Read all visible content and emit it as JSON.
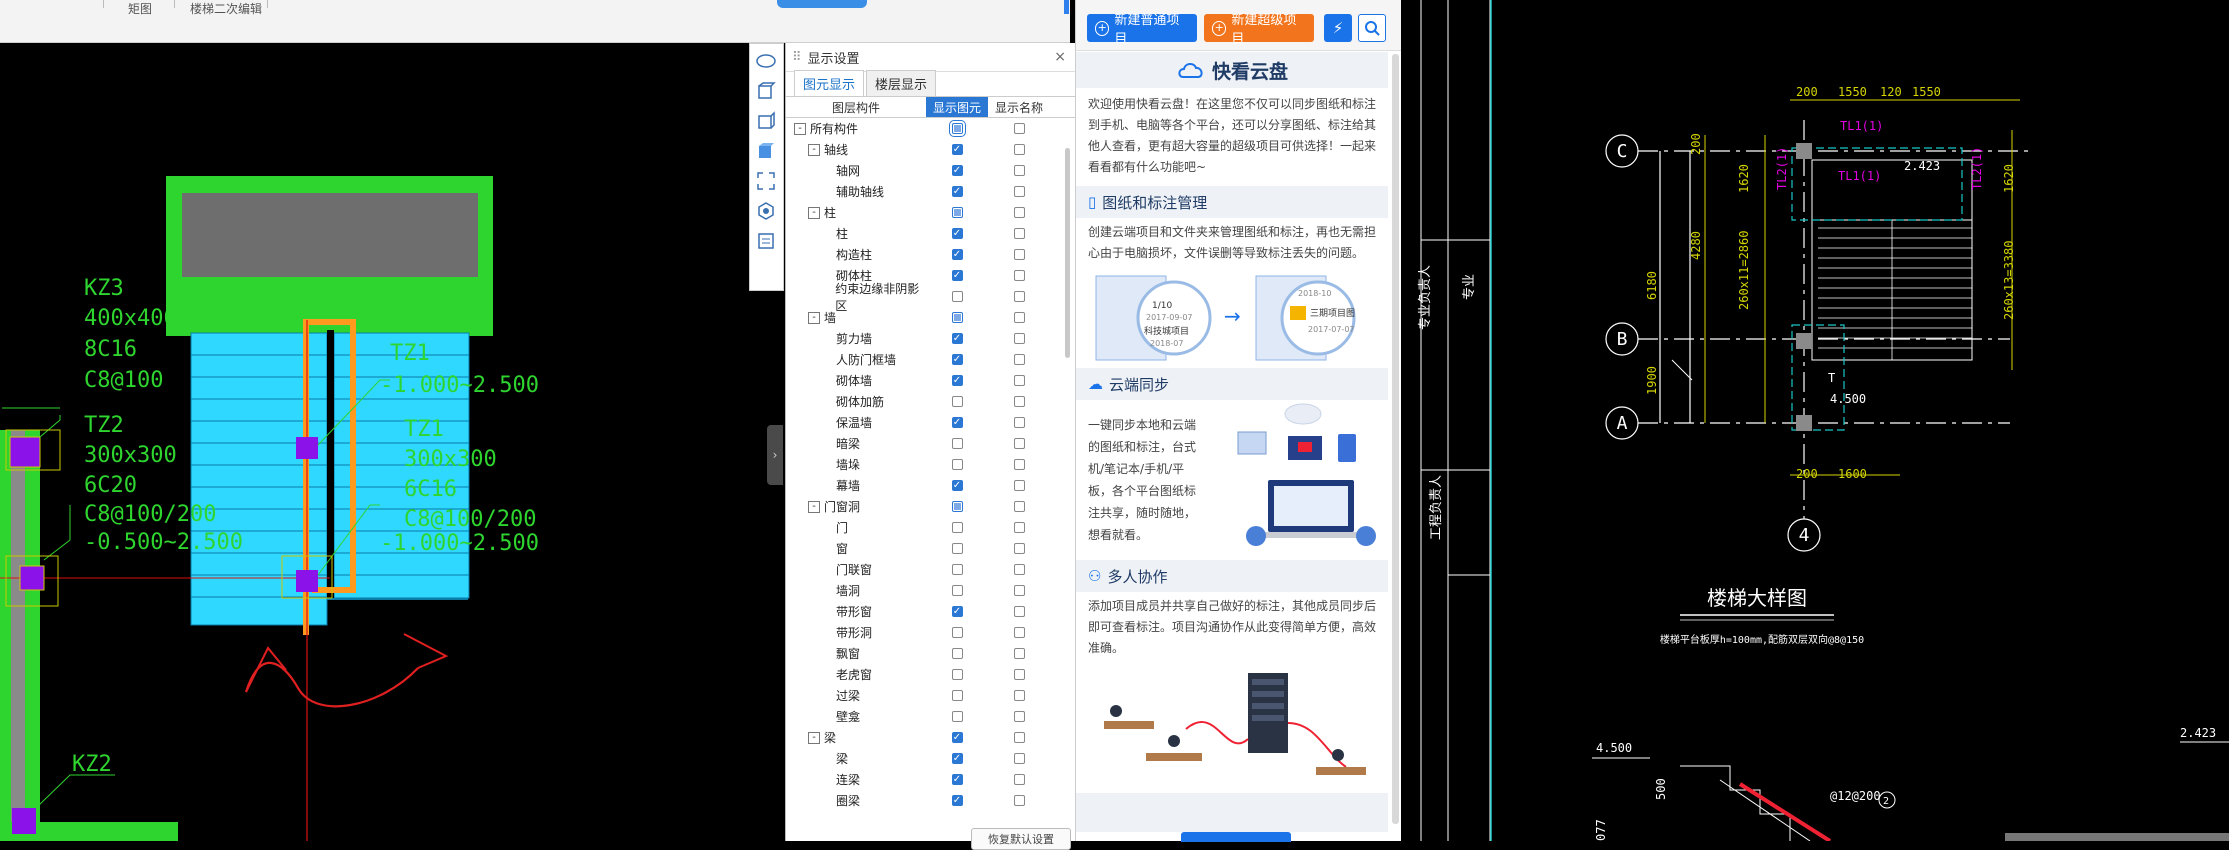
{
  "top_strip": {
    "items": [
      "矩图",
      "楼梯二次编辑"
    ]
  },
  "display_panel": {
    "title": "显示设置",
    "tabs": [
      "图元显示",
      "楼层显示"
    ],
    "columns": [
      "图层构件",
      "显示图元",
      "显示名称"
    ],
    "rows": [
      {
        "name": "所有构件",
        "level": 0,
        "exp": "-",
        "show": "part",
        "label": false
      },
      {
        "name": "轴线",
        "level": 1,
        "exp": "-",
        "show": true,
        "label": false
      },
      {
        "name": "轴网",
        "level": 2,
        "show": true,
        "label": false
      },
      {
        "name": "辅助轴线",
        "level": 2,
        "show": true,
        "label": false
      },
      {
        "name": "柱",
        "level": 1,
        "exp": "-",
        "show": "part",
        "label": false
      },
      {
        "name": "柱",
        "level": 2,
        "show": true,
        "label": false
      },
      {
        "name": "构造柱",
        "level": 2,
        "show": true,
        "label": false
      },
      {
        "name": "砌体柱",
        "level": 2,
        "show": true,
        "label": false
      },
      {
        "name": "约束边缘非阴影区",
        "level": 2,
        "show": false,
        "label": false
      },
      {
        "name": "墙",
        "level": 1,
        "exp": "-",
        "show": "part",
        "label": false
      },
      {
        "name": "剪力墙",
        "level": 2,
        "show": true,
        "label": false
      },
      {
        "name": "人防门框墙",
        "level": 2,
        "show": true,
        "label": false
      },
      {
        "name": "砌体墙",
        "level": 2,
        "show": true,
        "label": false
      },
      {
        "name": "砌体加筋",
        "level": 2,
        "show": false,
        "label": false
      },
      {
        "name": "保温墙",
        "level": 2,
        "show": true,
        "label": false
      },
      {
        "name": "暗梁",
        "level": 2,
        "show": false,
        "label": false
      },
      {
        "name": "墙垛",
        "level": 2,
        "show": false,
        "label": false
      },
      {
        "name": "幕墙",
        "level": 2,
        "show": true,
        "label": false
      },
      {
        "name": "门窗洞",
        "level": 1,
        "exp": "-",
        "show": "part",
        "label": false
      },
      {
        "name": "门",
        "level": 2,
        "show": false,
        "label": false
      },
      {
        "name": "窗",
        "level": 2,
        "show": false,
        "label": false
      },
      {
        "name": "门联窗",
        "level": 2,
        "show": false,
        "label": false
      },
      {
        "name": "墙洞",
        "level": 2,
        "show": false,
        "label": false
      },
      {
        "name": "带形窗",
        "level": 2,
        "show": true,
        "label": false
      },
      {
        "name": "带形洞",
        "level": 2,
        "show": false,
        "label": false
      },
      {
        "name": "飘窗",
        "level": 2,
        "show": false,
        "label": false
      },
      {
        "name": "老虎窗",
        "level": 2,
        "show": false,
        "label": false
      },
      {
        "name": "过梁",
        "level": 2,
        "show": false,
        "label": false
      },
      {
        "name": "壁龛",
        "level": 2,
        "show": false,
        "label": false
      },
      {
        "name": "梁",
        "level": 1,
        "exp": "-",
        "show": true,
        "label": false
      },
      {
        "name": "梁",
        "level": 2,
        "show": true,
        "label": false
      },
      {
        "name": "连梁",
        "level": 2,
        "show": true,
        "label": false
      },
      {
        "name": "圈梁",
        "level": 2,
        "show": true,
        "label": false
      }
    ],
    "footer_button": "恢复默认设置"
  },
  "cloud_panel": {
    "btn_new_normal": "新建普通项目",
    "btn_new_super": "新建超级项目",
    "title": "快看云盘",
    "intro": "欢迎使用快看云盘！在这里您不仅可以同步图纸和标注到手机、电脑等各个平台，还可以分享图纸、标注给其他人查看，更有超大容量的超级项目可供选择！一起来看看都有什么功能吧~",
    "sections": [
      {
        "title": "图纸和标注管理",
        "text": "创建云端项目和文件夹来管理图纸和标注，再也无需担心由于电脑损坏，文件误删等导致标注丢失的问题。"
      },
      {
        "title": "云端同步",
        "text": "一键同步本地和云端的图纸和标注，台式机/笔记本/手机/平板，各个平台图纸标注共享，随时随地，想看就看。"
      },
      {
        "title": "多人协作",
        "text": "添加项目成员并共享自己做好的标注，其他成员同步后即可查看标注。项目沟通协作从此变得简单方便，高效准确。"
      }
    ],
    "illus_labels": [
      "1/10",
      "2017-09-07",
      "科技城项目",
      "2018-07",
      "2018-10",
      "三期项目图",
      "2017-07-07"
    ]
  },
  "cad_left": {
    "labels": {
      "kz3": "KZ3",
      "kz3_size": "400x400",
      "kz3_bars": "8C16",
      "kz3_stir": "C8@100",
      "tz2": "TZ2",
      "tz2_size": "300x300",
      "tz2_bars": "6C20",
      "tz2_stir": "C8@100/200",
      "tz2_elev": "-0.500~2.500",
      "tz1a": "TZ1",
      "tz1a_elev": "-1.000~2.500",
      "tz1b": "TZ1",
      "tz1b_size": "300x300",
      "tz1b_bars": "6C16",
      "tz1b_stir": "C8@100/200",
      "tz1b_elev": "-1.000~2.500",
      "kz2": "KZ2"
    }
  },
  "cad_right": {
    "labels": {
      "axis_c": "C",
      "axis_b": "B",
      "axis_a": "A",
      "axis_4": "4",
      "d200a": "200",
      "d1550a": "1550",
      "d120": "120",
      "d1550b": "1550",
      "d200b": "200",
      "d1600": "1600",
      "d1620a": "1620",
      "d1620b": "1620",
      "d4280": "4280",
      "d6180": "6180",
      "d1900": "1900",
      "stepsA": "260x11=2860",
      "stepsB": "260x13=3380",
      "tl1a": "TL1(1)",
      "tl1b": "TL1(1)",
      "tl2a": "TL2(1)",
      "tl2b": "TL2(1)",
      "elev1": "2.423",
      "elev2": "4.500",
      "elev3": "4.500",
      "elev4": "2.423",
      "stair_t": "T",
      "title": "楼梯大样图",
      "note": "楼梯平台板厚h=100mm,配筋双层双向@8@150",
      "d500": "500",
      "d077": "077",
      "rebar": "@12@200",
      "circ2": "2",
      "sheet1": "专业负责人",
      "sheet1b": "专业",
      "sheet2": "工程负责人"
    }
  }
}
